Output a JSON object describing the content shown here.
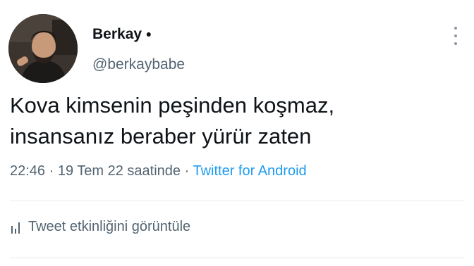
{
  "user": {
    "display_name": "Berkay",
    "name_dot": "•",
    "handle": "@berkaybabe"
  },
  "tweet": {
    "lines": [
      "Kova kimsenin peşinden koşmaz,",
      "insansanız beraber yürür zaten"
    ]
  },
  "meta": {
    "time": "22:46",
    "sep1": " · ",
    "date": "19 Tem 22 saatinde",
    "sep2": " · ",
    "source": "Twitter for Android"
  },
  "activity": {
    "icon": "bar-chart-icon",
    "label": "Tweet etkinliğini görüntüle"
  },
  "icons": {
    "more": "more-vertical-icon",
    "avatar": "avatar"
  },
  "colors": {
    "text": "#0f1419",
    "secondary": "#536471",
    "link": "#1d9bf0",
    "divider": "#e6e9ec"
  }
}
